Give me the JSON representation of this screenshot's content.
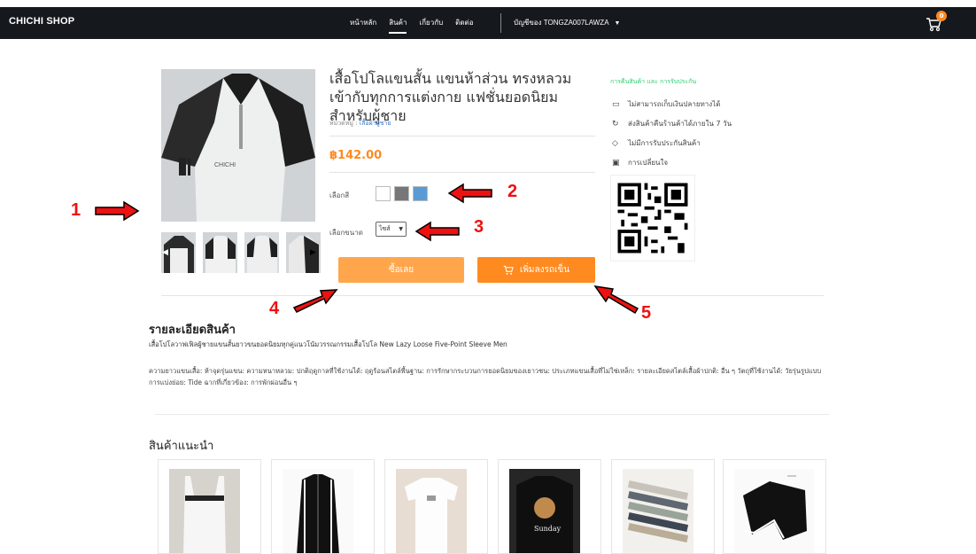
{
  "header": {
    "brand": "CHICHI SHOP",
    "nav": [
      {
        "label": "หน้าหลัก",
        "active": false
      },
      {
        "label": "สินค้า",
        "active": true
      },
      {
        "label": "เกี่ยวกับ",
        "active": false
      },
      {
        "label": "ติดต่อ",
        "active": false
      }
    ],
    "account": "บัญชีของ TONGZA007LAWZA",
    "cart_count": "0"
  },
  "product": {
    "title": "เสื้อโปโลแขนสั้น แขนห้าส่วน ทรงหลวม เข้ากับทุกการแต่งกาย แฟชั่นยอดนิยม สำหรับผู้ชาย",
    "category_label": "หมวดหมู่ :",
    "category_value": "เสื้อผ้าผู้ชาย",
    "price": "฿142.00",
    "color_label": "เลือกสี",
    "colors": [
      "#ffffff",
      "#777777",
      "#5b9bd5"
    ],
    "size_label": "เลือกขนาด",
    "size_value": "ไซส์",
    "buy_now": "ซื้อเลย",
    "add_to_cart": "เพิ่มลงรถเข็น"
  },
  "policies": {
    "title": "การคืนสินค้า และ การรับประกัน",
    "items": [
      {
        "icon": "cash-icon",
        "label": "ไม่สามารถเก็บเงินปลายทางได้"
      },
      {
        "icon": "return-icon",
        "label": "ส่งสินค้าคืนร้านค้าได้ภายใน 7 วัน"
      },
      {
        "icon": "shield-icon",
        "label": "ไม่มีการรับประกันสินค้า"
      },
      {
        "icon": "gift-icon",
        "label": "การเปลี่ยนใจ"
      }
    ]
  },
  "description": {
    "title": "รายละเอียดสินค้า",
    "subtitle": "เสื้อโปโลวาฟเฟิลผู้ชายแขนสั้นยาวขนยอดนิยมทุกคู่แนวโน้มวรรณกรรมเสื้อโปโล New Lazy Loose Five-Point Sleeve Men",
    "body": "ความยาวแขนเสื้อ: ห้าจุดรุ่นแขน: ความหนาหลวม: ปกติฤดูกาลที่ใช้งานได้: ฤดูร้อนสไตล์พื้นฐาน: การรักษากระบวนการยอดนิยมของเยาวชน: ประเภทแขนเสื้อที่ไม่ใช่เหล็ก: รายละเอียดสไตล์เสื้อผ้าปกติ: อื่น ๆ วัตถุที่ใช้งานได้: วัยรุ่นรูปแบบการแบ่งย่อย: Tide ฉากที่เกี่ยวข้อง: การพักผ่อนอื่น ๆ"
  },
  "recommended": {
    "title": "สินค้าแนะนำ",
    "items": [
      {
        "kind": "white-tank-top"
      },
      {
        "kind": "black-track-jacket"
      },
      {
        "kind": "white-tshirt"
      },
      {
        "kind": "black-sweatshirt"
      },
      {
        "kind": "pants-stack"
      },
      {
        "kind": "black-shorts"
      }
    ]
  },
  "annotations": [
    "1",
    "2",
    "3",
    "4",
    "5"
  ],
  "colors": {
    "topbar": "#15181d",
    "accent": "#ff8a1f",
    "accent_light": "#ffa64d",
    "annotation": "#e11111"
  }
}
